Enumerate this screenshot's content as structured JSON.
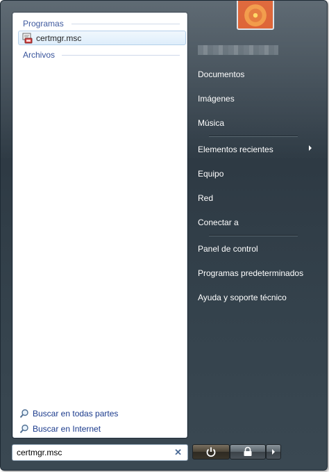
{
  "left_panel": {
    "sections": {
      "programs": "Programas",
      "files": "Archivos"
    },
    "result": {
      "label": "certmgr.msc",
      "icon": "certificate-manager-icon"
    },
    "search_links": [
      {
        "label": "Buscar en todas partes",
        "icon": "magnifier-icon"
      },
      {
        "label": "Buscar en Internet",
        "icon": "magnifier-icon"
      }
    ]
  },
  "search": {
    "value": "certmgr.msc",
    "clear_icon": "✕"
  },
  "right_panel": {
    "items": [
      {
        "label": "Documentos"
      },
      {
        "label": "Imágenes"
      },
      {
        "label": "Música"
      },
      {
        "label": "Elementos recientes"
      },
      {
        "label": "Equipo"
      },
      {
        "label": "Red"
      },
      {
        "label": "Conectar a"
      },
      {
        "label": "Panel de control"
      },
      {
        "label": "Programas predeterminados"
      },
      {
        "label": "Ayuda y soporte técnico"
      }
    ]
  },
  "buttons": {
    "power_icon": "power-icon",
    "lock_icon": "lock-icon",
    "more_icon": "triangle-right-icon"
  },
  "colors": {
    "link_blue": "#1a3a8c",
    "panel_dark": "#2e3a44"
  }
}
